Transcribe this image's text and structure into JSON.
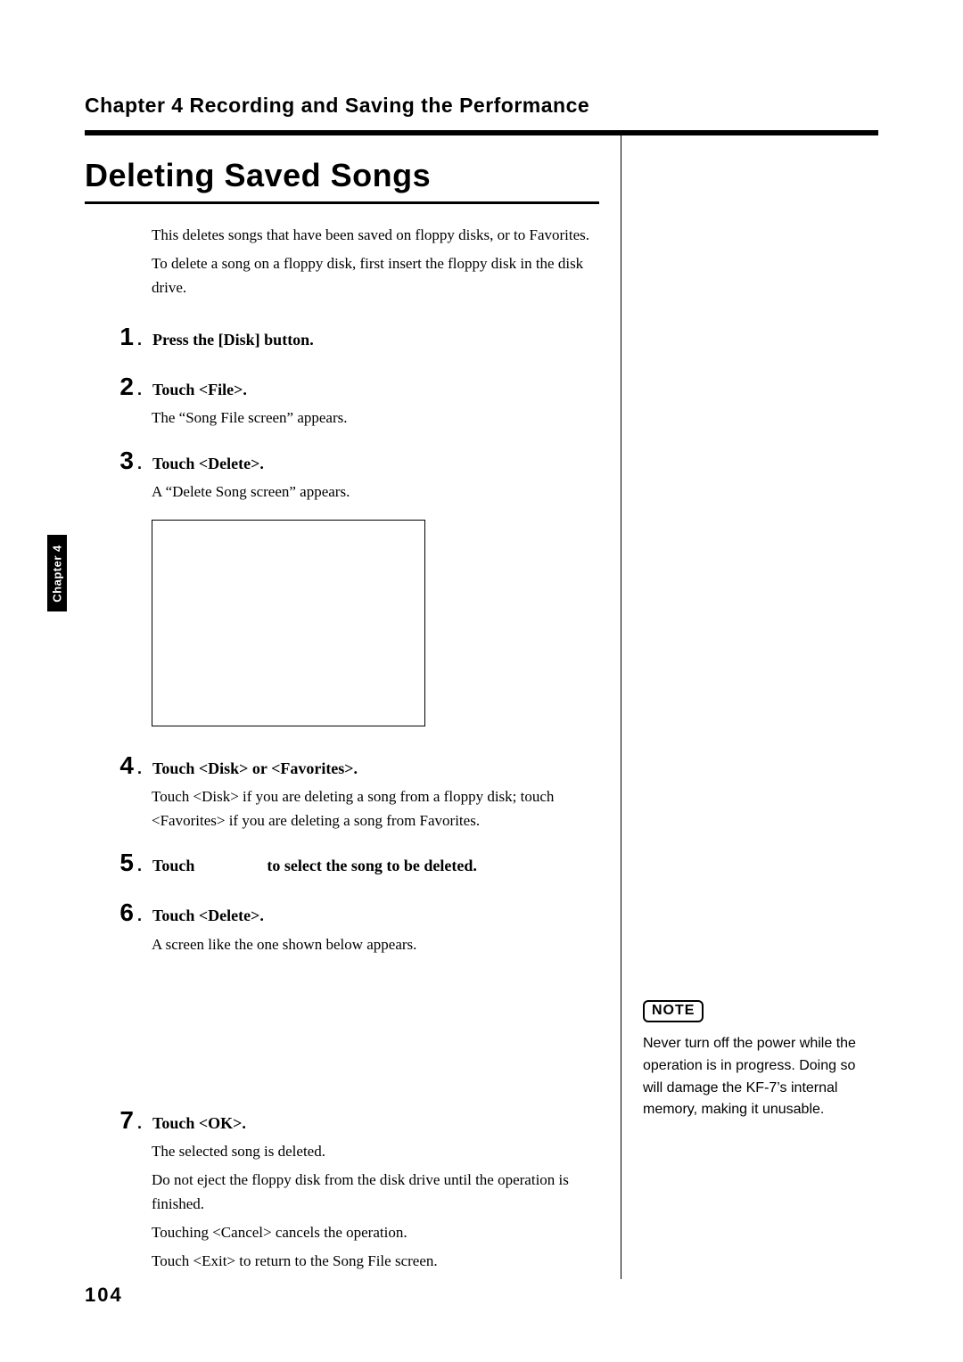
{
  "header": {
    "chapter_line": "Chapter 4 Recording and Saving the Performance"
  },
  "tab": {
    "label": "Chapter 4"
  },
  "section": {
    "title": "Deleting Saved Songs",
    "intro_1": "This deletes songs that have been saved on floppy disks, or to Favorites.",
    "intro_2": "To delete a song on a floppy disk, first insert the floppy disk in the disk drive."
  },
  "steps": {
    "s1": {
      "num": "1",
      "bold": "Press the [Disk] button."
    },
    "s2": {
      "num": "2",
      "bold": "Touch <File>.",
      "note": "The “Song File screen” appears."
    },
    "s3": {
      "num": "3",
      "bold": "Touch <Delete>.",
      "note": "A “Delete Song screen” appears."
    },
    "s4": {
      "num": "4",
      "bold": "Touch <Disk> or <Favorites>.",
      "note": "Touch <Disk> if you are deleting a song from a floppy disk; touch <Favorites> if you are deleting a song from Favorites."
    },
    "s5": {
      "num": "5",
      "bold_a": "Touch",
      "bold_b": "to select the song to be deleted."
    },
    "s6": {
      "num": "6",
      "bold": "Touch <Delete>.",
      "note": "A screen like the one shown below appears."
    },
    "s7": {
      "num": "7",
      "bold": "Touch <OK>.",
      "note_a": "The selected song is deleted.",
      "note_b": "Do not eject the floppy disk from the disk drive until the operation is finished.",
      "note_c": "Touching <Cancel> cancels the operation.",
      "note_d": "Touch <Exit> to return to the Song File screen."
    }
  },
  "sidebar": {
    "note_badge": "NOTE",
    "note_text": "Never turn off the power while the operation is in progress. Doing so will damage the KF-7’s internal memory, making it unusable."
  },
  "footer": {
    "page_number": "104"
  }
}
